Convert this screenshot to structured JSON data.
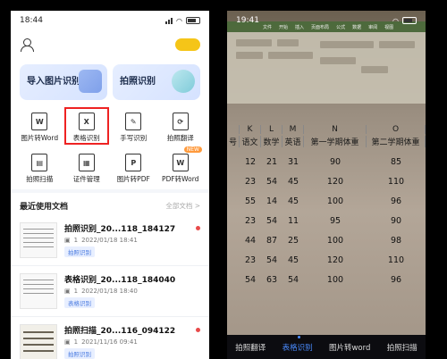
{
  "left": {
    "status_time": "18:44",
    "cards": [
      {
        "label": "导入图片识别"
      },
      {
        "label": "拍照识别"
      }
    ],
    "tools": [
      {
        "label": "图片转Word",
        "glyph": "W"
      },
      {
        "label": "表格识别",
        "glyph": "X"
      },
      {
        "label": "手写识别",
        "glyph": "✎"
      },
      {
        "label": "拍照翻译",
        "glyph": "⟳"
      },
      {
        "label": "拍照扫描",
        "glyph": "▤"
      },
      {
        "label": "证件管理",
        "glyph": "▦"
      },
      {
        "label": "图片转PDF",
        "glyph": "P"
      },
      {
        "label": "PDF转Word",
        "glyph": "W",
        "badge": "NEW"
      }
    ],
    "recent_title": "最近使用文档",
    "recent_all": "全部文档 >",
    "docs": [
      {
        "name": "拍照识别_20...118_184127",
        "meta_count": "1",
        "date": "2022/01/18 18:41",
        "tag": "拍照识别"
      },
      {
        "name": "表格识别_20...118_184040",
        "meta_count": "1",
        "date": "2022/01/18 18:40",
        "tag": "表格识别"
      },
      {
        "name": "拍照扫描_20...116_094122",
        "meta_count": "1",
        "date": "2021/11/16 09:41",
        "tag": "拍照识别"
      }
    ]
  },
  "right": {
    "status_time": "19:41",
    "ribbon_tabs": [
      "文件",
      "开始",
      "插入",
      "页面布局",
      "公式",
      "数据",
      "审阅",
      "视图"
    ],
    "col_letters": [
      "K",
      "L",
      "M",
      "N",
      "O"
    ],
    "headers": [
      "号",
      "语文",
      "数学",
      "英语",
      "第一学期体重",
      "第二学期体重"
    ],
    "rows": [
      [
        "",
        "12",
        "21",
        "31",
        "90",
        "85"
      ],
      [
        "",
        "23",
        "54",
        "45",
        "120",
        "110"
      ],
      [
        "",
        "55",
        "14",
        "45",
        "100",
        "96"
      ],
      [
        "",
        "23",
        "54",
        "11",
        "95",
        "90"
      ],
      [
        "",
        "44",
        "87",
        "25",
        "100",
        "98"
      ],
      [
        "",
        "23",
        "54",
        "45",
        "120",
        "110"
      ],
      [
        "",
        "54",
        "63",
        "54",
        "100",
        "96"
      ]
    ],
    "nav": [
      {
        "label": "拍照翻译",
        "active": false
      },
      {
        "label": "表格识别",
        "active": true
      },
      {
        "label": "图片转word",
        "active": false
      },
      {
        "label": "拍照扫描",
        "active": false
      }
    ]
  }
}
